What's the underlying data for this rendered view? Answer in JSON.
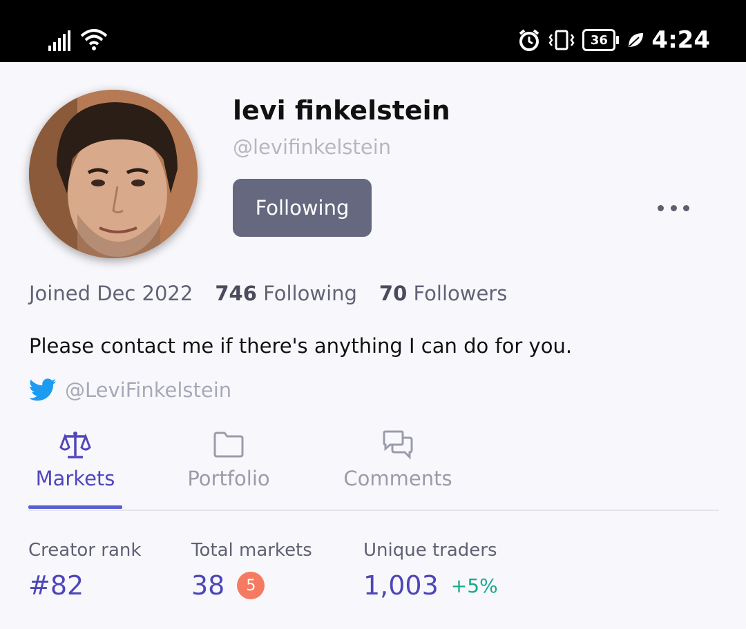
{
  "status_bar": {
    "time": "4:24",
    "battery": "36",
    "icons": [
      "signal-icon",
      "wifi-icon",
      "alarm-icon",
      "vibrate-icon",
      "battery-icon",
      "leaf-icon"
    ]
  },
  "profile": {
    "name": "levi finkelstein",
    "handle": "@levifinkelstein",
    "follow_label": "Following",
    "joined": "Joined Dec 2022",
    "following_count": "746",
    "following_label": "Following",
    "followers_count": "70",
    "followers_label": "Followers",
    "bio": "Please contact me if there's anything I can do for you.",
    "twitter_handle": "@LeviFinkelstein"
  },
  "tabs": [
    {
      "label": "Markets",
      "icon": "scale-icon",
      "active": true
    },
    {
      "label": "Portfolio",
      "icon": "folder-icon",
      "active": false
    },
    {
      "label": "Comments",
      "icon": "chat-bubbles-icon",
      "active": false
    }
  ],
  "metrics": {
    "creator_rank_label": "Creator rank",
    "creator_rank_value": "#82",
    "total_markets_label": "Total markets",
    "total_markets_value": "38",
    "total_markets_badge": "5",
    "unique_traders_label": "Unique traders",
    "unique_traders_value": "1,003",
    "unique_traders_delta": "+5%"
  },
  "colors": {
    "accent": "#5146bd",
    "button": "#666880",
    "badge": "#f47b62",
    "positive": "#16a98e",
    "twitter": "#1d9bf0"
  }
}
